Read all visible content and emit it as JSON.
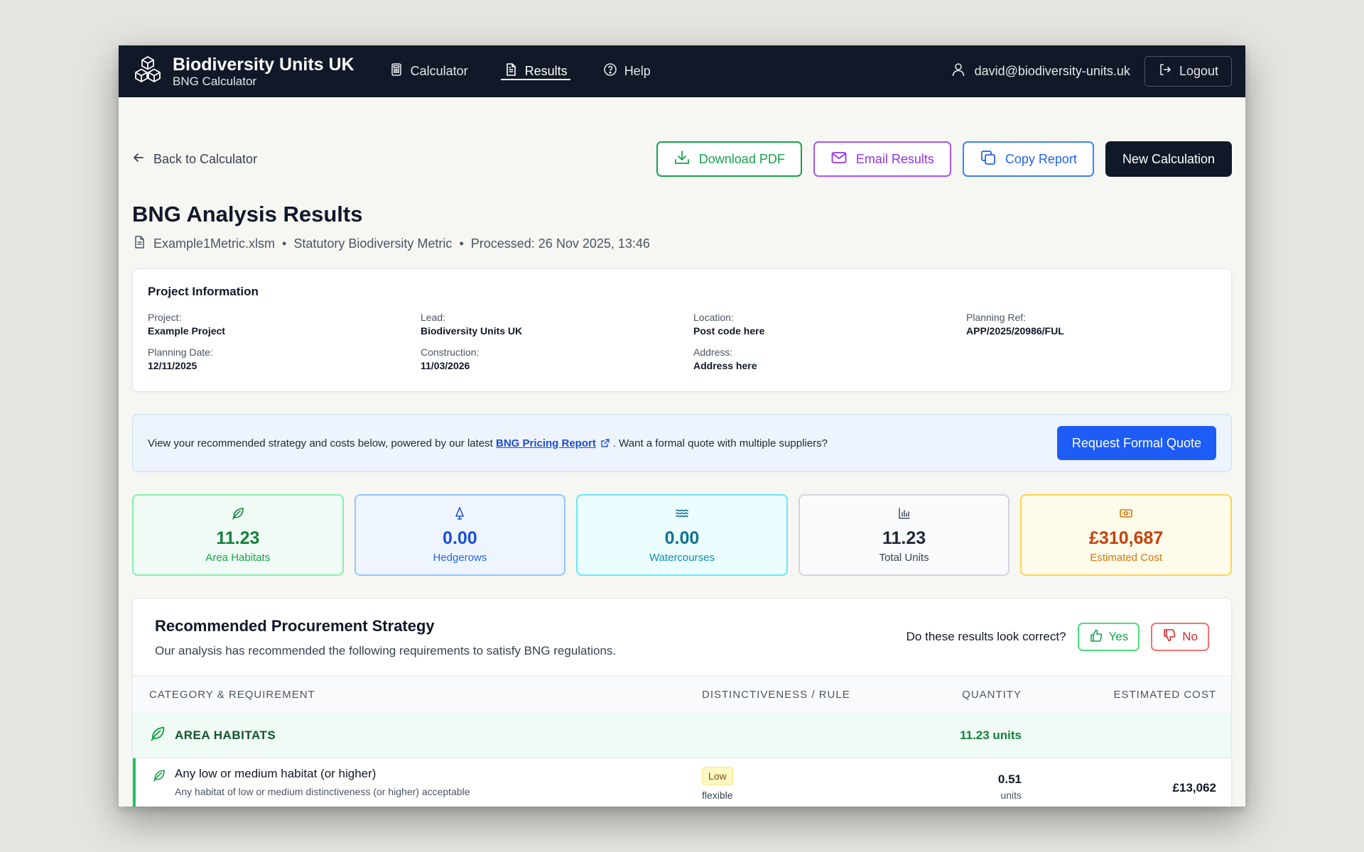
{
  "header": {
    "brand_title": "Biodiversity Units UK",
    "brand_subtitle": "BNG Calculator",
    "nav": [
      {
        "label": "Calculator",
        "icon": "calculator-icon"
      },
      {
        "label": "Results",
        "icon": "document-icon",
        "active": true
      },
      {
        "label": "Help",
        "icon": "help-circle-icon"
      }
    ],
    "user_email": "david@biodiversity-units.uk",
    "logout_label": "Logout"
  },
  "actions": {
    "back_label": "Back to Calculator",
    "download_pdf": "Download PDF",
    "email_results": "Email Results",
    "copy_report": "Copy Report",
    "new_calculation": "New Calculation"
  },
  "page": {
    "title": "BNG Analysis Results",
    "file_name": "Example1Metric.xlsm",
    "sep": "•",
    "metric_type": "Statutory Biodiversity Metric",
    "processed": "Processed: 26 Nov 2025, 13:46"
  },
  "project": {
    "heading": "Project Information",
    "fields": [
      {
        "label": "Project:",
        "value": "Example Project"
      },
      {
        "label": "Lead:",
        "value": "Biodiversity Units UK"
      },
      {
        "label": "Location:",
        "value": "Post code here"
      },
      {
        "label": "Planning Ref:",
        "value": "APP/2025/20986/FUL"
      },
      {
        "label": "Planning Date:",
        "value": "12/11/2025"
      },
      {
        "label": "Construction:",
        "value": "11/03/2026"
      },
      {
        "label": "Address:",
        "value": "Address here"
      }
    ]
  },
  "banner": {
    "text_before": "View your recommended strategy and costs below, powered by our latest ",
    "link_text": "BNG Pricing Report",
    "text_after": ". Want a formal quote with multiple suppliers?",
    "button_label": "Request Formal Quote"
  },
  "stats": [
    {
      "value": "11.23",
      "label": "Area Habitats",
      "icon": "leaf-icon"
    },
    {
      "value": "0.00",
      "label": "Hedgerows",
      "icon": "tree-icon"
    },
    {
      "value": "0.00",
      "label": "Watercourses",
      "icon": "waves-icon"
    },
    {
      "value": "11.23",
      "label": "Total Units",
      "icon": "bar-chart-icon"
    },
    {
      "value": "£310,687",
      "label": "Estimated Cost",
      "icon": "banknote-icon"
    }
  ],
  "strategy": {
    "title": "Recommended Procurement Strategy",
    "subtitle": "Our analysis has recommended the following requirements to satisfy BNG regulations.",
    "feedback_question": "Do these results look correct?",
    "yes_label": "Yes",
    "no_label": "No",
    "columns": [
      "CATEGORY & REQUIREMENT",
      "DISTINCTIVENESS / RULE",
      "QUANTITY",
      "ESTIMATED COST"
    ],
    "groups": [
      {
        "name": "AREA HABITATS",
        "quantity": "11.23 units",
        "items": [
          {
            "name": "Any low or medium habitat (or higher)",
            "description": "Any habitat of low or medium distinctiveness (or higher) acceptable",
            "badge": "Low",
            "rule": "flexible",
            "quantity": "0.51",
            "unit": "units",
            "cost": "£13,062"
          }
        ]
      }
    ]
  },
  "colors": {
    "header_bg": "#111827",
    "green": "#16a34a",
    "purple": "#9333ea",
    "blue": "#2563eb",
    "primary": "#1d5cf5",
    "amber": "#d97706"
  }
}
